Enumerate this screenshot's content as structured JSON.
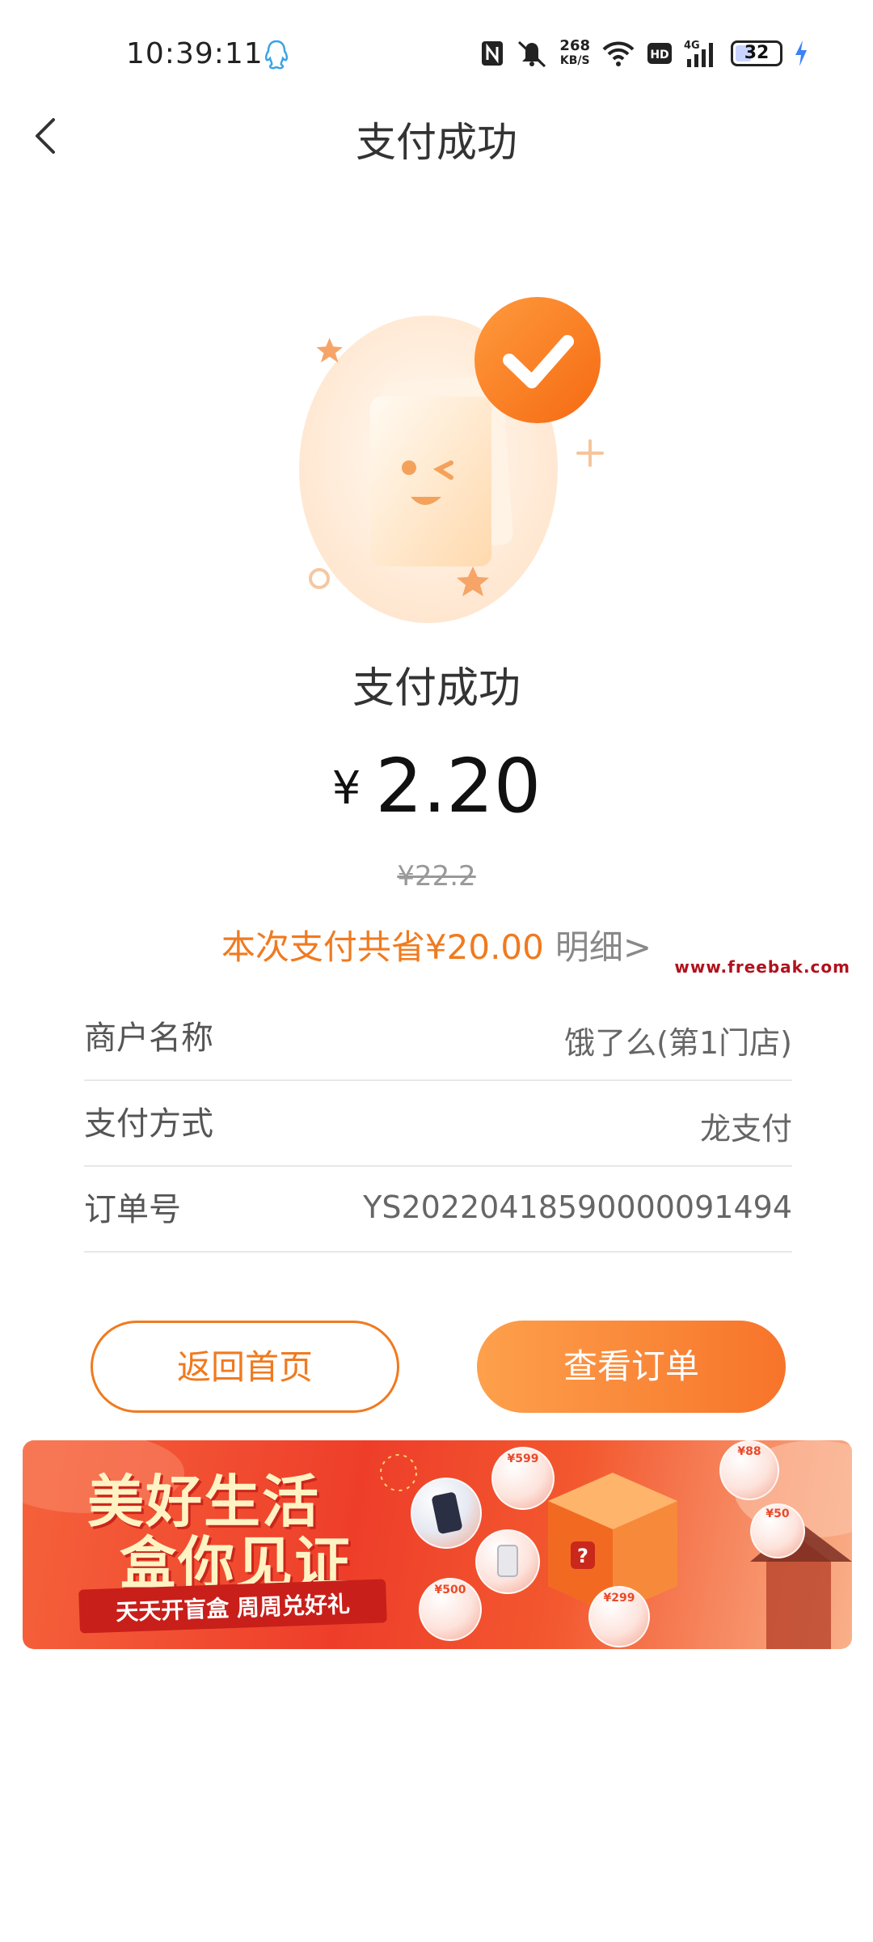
{
  "status_bar": {
    "time": "10:39:11",
    "net_speed_value": "268",
    "net_speed_unit": "KB/S",
    "battery": "32",
    "icons": [
      "qq-icon",
      "nfc-icon",
      "mute-icon",
      "wifi-icon",
      "hd-icon",
      "signal-4g-icon",
      "battery-icon",
      "charging-icon"
    ]
  },
  "nav": {
    "title": "支付成功"
  },
  "result": {
    "status_text": "支付成功",
    "currency_symbol": "¥",
    "amount": "2.20",
    "original_price": "¥22.2",
    "savings_text": "本次支付共省¥20.00",
    "detail_link": "明细>"
  },
  "watermark": "www.freebak.com",
  "info_rows": [
    {
      "label": "商户名称",
      "value": "饿了么(第1门店)"
    },
    {
      "label": "支付方式",
      "value": "龙支付"
    },
    {
      "label": "订单号",
      "value": "YS20220418590000091494"
    }
  ],
  "buttons": {
    "home": "返回首页",
    "view_order": "查看订单"
  },
  "banner": {
    "title_line1": "美好生活",
    "title_line2": "盒你见证",
    "subtitle": "天天开盲盒 周周兑好礼",
    "coupons": [
      "¥599",
      "¥500",
      "¥299",
      "¥88",
      "¥50"
    ]
  },
  "colors": {
    "accent": "#f07a1f",
    "button_gradient_start": "#fda04c",
    "button_gradient_end": "#f7742a"
  }
}
